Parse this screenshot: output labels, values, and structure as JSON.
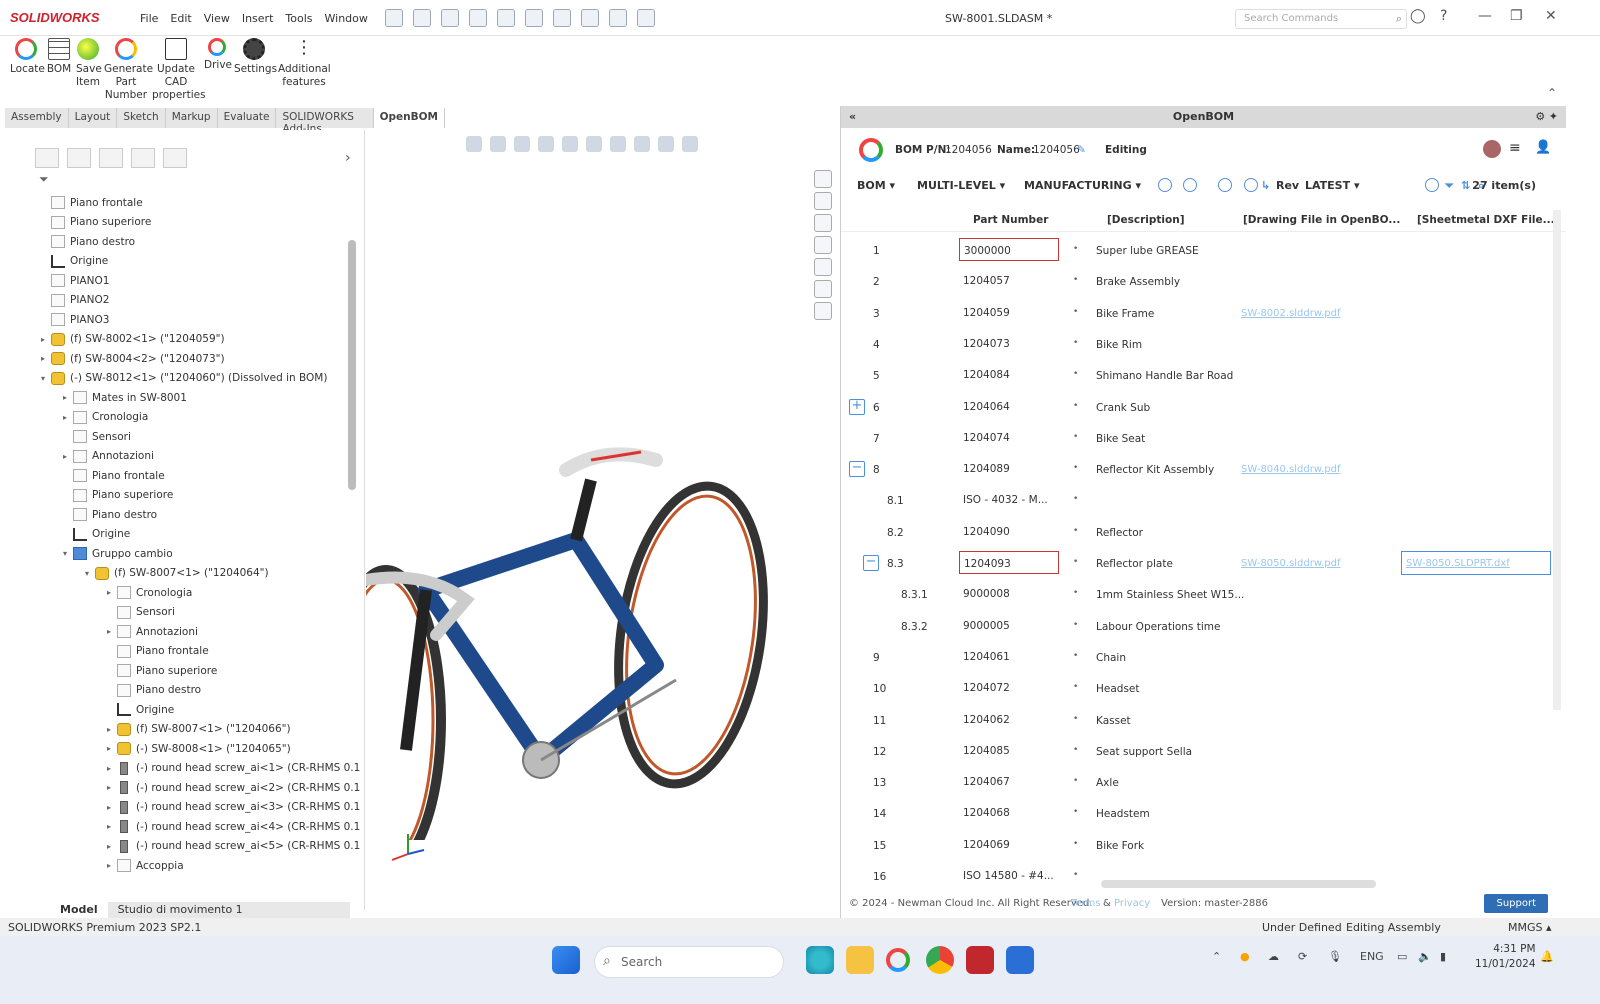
{
  "app": {
    "logo": "SOLIDWORKS",
    "menu": [
      "File",
      "Edit",
      "View",
      "Insert",
      "Tools",
      "Window"
    ],
    "doc_title": "SW-8001.SLDASM *",
    "search_placeholder": "Search Commands"
  },
  "ribbon": {
    "buttons": [
      {
        "label": "Locate"
      },
      {
        "label": "BOM"
      },
      {
        "label": "Save Item"
      },
      {
        "label": "Generate Part Number"
      },
      {
        "label": "Update CAD properties"
      },
      {
        "label": "Drive"
      },
      {
        "label": "Settings"
      },
      {
        "label": "Additional features"
      }
    ]
  },
  "tabs": [
    "Assembly",
    "Layout",
    "Sketch",
    "Markup",
    "Evaluate",
    "SOLIDWORKS Add-Ins",
    "OpenBOM"
  ],
  "tree": {
    "items": [
      {
        "label": "Piano frontale",
        "indent": 0,
        "type": "plane",
        "tw": ""
      },
      {
        "label": "Piano superiore",
        "indent": 0,
        "type": "plane",
        "tw": ""
      },
      {
        "label": "Piano destro",
        "indent": 0,
        "type": "plane",
        "tw": ""
      },
      {
        "label": "Origine",
        "indent": 0,
        "type": "origin",
        "tw": ""
      },
      {
        "label": "PIANO1",
        "indent": 0,
        "type": "plane",
        "tw": ""
      },
      {
        "label": "PIANO2",
        "indent": 0,
        "type": "plane",
        "tw": ""
      },
      {
        "label": "PIANO3",
        "indent": 0,
        "type": "plane",
        "tw": ""
      },
      {
        "label": "(f) SW-8002<1> (\"1204059\")",
        "indent": 0,
        "type": "asm",
        "tw": "▸"
      },
      {
        "label": "(f) SW-8004<2> (\"1204073\")",
        "indent": 0,
        "type": "asm",
        "tw": "▸"
      },
      {
        "label": "(-) SW-8012<1> (\"1204060\") (Dissolved in BOM)",
        "indent": 0,
        "type": "asm",
        "tw": "▾"
      },
      {
        "label": "Mates in SW-8001",
        "indent": 1,
        "type": "plane",
        "tw": "▸"
      },
      {
        "label": "Cronologia",
        "indent": 1,
        "type": "plane",
        "tw": "▸"
      },
      {
        "label": "Sensori",
        "indent": 1,
        "type": "plane",
        "tw": ""
      },
      {
        "label": "Annotazioni",
        "indent": 1,
        "type": "plane",
        "tw": "▸"
      },
      {
        "label": "Piano frontale",
        "indent": 1,
        "type": "plane",
        "tw": ""
      },
      {
        "label": "Piano superiore",
        "indent": 1,
        "type": "plane",
        "tw": ""
      },
      {
        "label": "Piano destro",
        "indent": 1,
        "type": "plane",
        "tw": ""
      },
      {
        "label": "Origine",
        "indent": 1,
        "type": "origin",
        "tw": ""
      },
      {
        "label": "Gruppo cambio",
        "indent": 1,
        "type": "folder",
        "tw": "▾"
      },
      {
        "label": "(f) SW-8007<1> (\"1204064\")",
        "indent": 2,
        "type": "asm",
        "tw": "▾"
      },
      {
        "label": "Cronologia",
        "indent": 3,
        "type": "plane",
        "tw": "▸"
      },
      {
        "label": "Sensori",
        "indent": 3,
        "type": "plane",
        "tw": ""
      },
      {
        "label": "Annotazioni",
        "indent": 3,
        "type": "plane",
        "tw": "▸"
      },
      {
        "label": "Piano frontale",
        "indent": 3,
        "type": "plane",
        "tw": ""
      },
      {
        "label": "Piano superiore",
        "indent": 3,
        "type": "plane",
        "tw": ""
      },
      {
        "label": "Piano destro",
        "indent": 3,
        "type": "plane",
        "tw": ""
      },
      {
        "label": "Origine",
        "indent": 3,
        "type": "origin",
        "tw": ""
      },
      {
        "label": "(f) SW-8007<1> (\"1204066\")",
        "indent": 3,
        "type": "asm",
        "tw": "▸"
      },
      {
        "label": "(-) SW-8008<1> (\"1204065\")",
        "indent": 3,
        "type": "asm",
        "tw": "▸"
      },
      {
        "label": "(-) round head screw_ai<1> (CR-RHMS 0.1",
        "indent": 3,
        "type": "screw",
        "tw": "▸"
      },
      {
        "label": "(-) round head screw_ai<2> (CR-RHMS 0.1",
        "indent": 3,
        "type": "screw",
        "tw": "▸"
      },
      {
        "label": "(-) round head screw_ai<3> (CR-RHMS 0.1",
        "indent": 3,
        "type": "screw",
        "tw": "▸"
      },
      {
        "label": "(-) round head screw_ai<4> (CR-RHMS 0.1",
        "indent": 3,
        "type": "screw",
        "tw": "▸"
      },
      {
        "label": "(-) round head screw_ai<5> (CR-RHMS 0.1",
        "indent": 3,
        "type": "screw",
        "tw": "▸"
      },
      {
        "label": "Accoppia",
        "indent": 3,
        "type": "plane",
        "tw": "▸"
      }
    ]
  },
  "bottom_tabs": [
    "Model",
    "Studio di movimento 1"
  ],
  "openbom": {
    "panel_title": "OpenBOM",
    "bom_pn_label": "BOM P/N:",
    "bom_pn": "1204056",
    "name_label": "Name:",
    "name": "1204056",
    "mode": "Editing",
    "toolbar": {
      "bom": "BOM",
      "multilevel": "MULTI-LEVEL",
      "manufacturing": "MANUFACTURING",
      "rev": "Rev",
      "rev_value": "LATEST",
      "count": "27 item(s)"
    },
    "columns": [
      "Part Number",
      "[Description]",
      "[Drawing File in OpenBO...",
      "[Sheetmetal DXF File..."
    ],
    "rows": [
      {
        "num": "1",
        "pn": "3000000",
        "desc": "Super lube GREASE",
        "link": "",
        "level": 0,
        "sel": true
      },
      {
        "num": "2",
        "pn": "1204057",
        "desc": "Brake Assembly",
        "link": "",
        "level": 0
      },
      {
        "num": "3",
        "pn": "1204059",
        "desc": "Bike Frame",
        "link": "SW-8002.slddrw.pdf",
        "level": 0
      },
      {
        "num": "4",
        "pn": "1204073",
        "desc": "Bike Rim",
        "link": "",
        "level": 0
      },
      {
        "num": "5",
        "pn": "1204084",
        "desc": "Shimano Handle Bar Road",
        "link": "",
        "level": 0
      },
      {
        "num": "6",
        "pn": "1204064",
        "desc": "Crank Sub",
        "link": "",
        "level": 0,
        "exp": "+"
      },
      {
        "num": "7",
        "pn": "1204074",
        "desc": "Bike Seat",
        "link": "",
        "level": 0
      },
      {
        "num": "8",
        "pn": "1204089",
        "desc": "Reflector Kit Assembly",
        "link": "SW-8040.slddrw.pdf",
        "level": 0,
        "exp": "−"
      },
      {
        "num": "8.1",
        "pn": "ISO - 4032 - M...",
        "desc": "",
        "link": "",
        "level": 1
      },
      {
        "num": "8.2",
        "pn": "1204090",
        "desc": "Reflector",
        "link": "",
        "level": 1
      },
      {
        "num": "8.3",
        "pn": "1204093",
        "desc": "Reflector plate",
        "link": "SW-8050.slddrw.pdf",
        "link2": "SW-8050.SLDPRT.dxf",
        "level": 1,
        "exp": "−",
        "sel": true
      },
      {
        "num": "8.3.1",
        "pn": "9000008",
        "desc": "1mm Stainless Sheet W15...",
        "link": "",
        "level": 2
      },
      {
        "num": "8.3.2",
        "pn": "9000005",
        "desc": "Labour Operations time",
        "link": "",
        "level": 2
      },
      {
        "num": "9",
        "pn": "1204061",
        "desc": "Chain",
        "link": "",
        "level": 0
      },
      {
        "num": "10",
        "pn": "1204072",
        "desc": "Headset",
        "link": "",
        "level": 0
      },
      {
        "num": "11",
        "pn": "1204062",
        "desc": "Kasset",
        "link": "",
        "level": 0
      },
      {
        "num": "12",
        "pn": "1204085",
        "desc": "Seat support Sella",
        "link": "",
        "level": 0
      },
      {
        "num": "13",
        "pn": "1204067",
        "desc": "Axle",
        "link": "",
        "level": 0
      },
      {
        "num": "14",
        "pn": "1204068",
        "desc": "Headstem",
        "link": "",
        "level": 0
      },
      {
        "num": "15",
        "pn": "1204069",
        "desc": "Bike Fork",
        "link": "",
        "level": 0
      },
      {
        "num": "16",
        "pn": "ISO 14580 - #4...",
        "desc": "",
        "link": "",
        "level": 0
      }
    ],
    "footer": {
      "copyright": "© 2024 - Newman Cloud Inc. All Right Reserved.",
      "terms": "Terms",
      "amp": "&",
      "privacy": "Privacy",
      "version": "Version: master-2886",
      "support": "Support"
    }
  },
  "status": {
    "product": "SOLIDWORKS Premium 2023 SP2.1",
    "defined": "Under Defined",
    "editing": "Editing Assembly",
    "units": "MMGS"
  },
  "taskbar": {
    "search": "Search",
    "lang": "ENG",
    "time": "4:31 PM",
    "date": "11/01/2024"
  },
  "colors": {
    "accent": "#2f6db5",
    "brand_red": "#d0202d",
    "bike_frame": "#1e4a8c"
  }
}
